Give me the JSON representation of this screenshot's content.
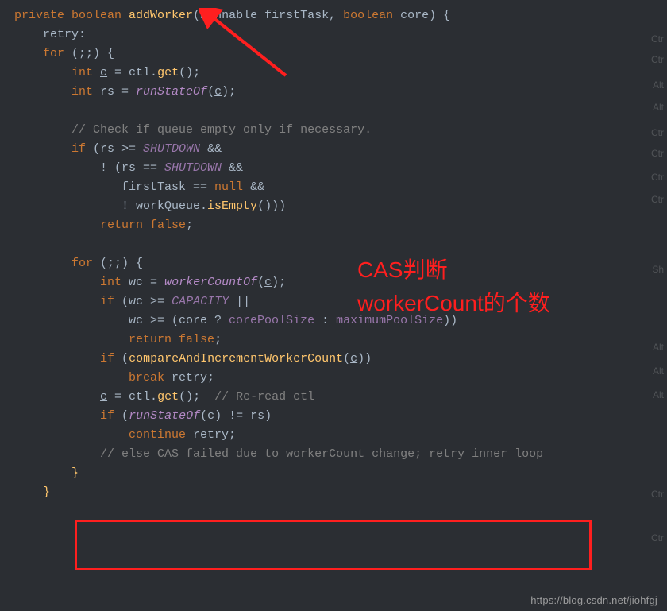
{
  "code": {
    "l0": {
      "a": "private ",
      "b": "boolean ",
      "c": "addWorker",
      "d": "(",
      "e": "Runnable ",
      "f": "firstTask",
      "g": ", ",
      "h": "boolean ",
      "i": "core",
      "j": ") {"
    },
    "l1": "    retry:",
    "l2": {
      "a": "    ",
      "b": "for ",
      "c": "(;;) {"
    },
    "l3": {
      "a": "        ",
      "b": "int ",
      "c": "c",
      "d": " = ctl.",
      "e": "get",
      "f": "();"
    },
    "l4": {
      "a": "        ",
      "b": "int ",
      "c": "rs = ",
      "d": "runStateOf",
      "e": "(",
      "f": "c",
      "g": ");"
    },
    "l5": "",
    "l6": {
      "a": "        ",
      "b": "// Check if queue empty only if necessary."
    },
    "l7": {
      "a": "        ",
      "b": "if ",
      "c": "(rs >= ",
      "d": "SHUTDOWN ",
      "e": "&&"
    },
    "l8": {
      "a": "            ! (rs == ",
      "b": "SHUTDOWN ",
      "c": "&&"
    },
    "l9": {
      "a": "               firstTask == ",
      "b": "null ",
      "c": "&&"
    },
    "l10": {
      "a": "               ! workQueue.",
      "b": "isEmpty",
      "c": "()))"
    },
    "l11": {
      "a": "            ",
      "b": "return false",
      "c": ";"
    },
    "l12": "",
    "l13": {
      "a": "        ",
      "b": "for ",
      "c": "(;;) {"
    },
    "l14": {
      "a": "            ",
      "b": "int ",
      "c": "wc = ",
      "d": "workerCountOf",
      "e": "(",
      "f": "c",
      "g": ");"
    },
    "l15": {
      "a": "            ",
      "b": "if ",
      "c": "(wc >= ",
      "d": "CAPACITY ",
      "e": "||"
    },
    "l16": {
      "a": "                wc >= (core ? ",
      "b": "corePoolSize ",
      "c": ": ",
      "d": "maximumPoolSize",
      "e": "))"
    },
    "l17": {
      "a": "                ",
      "b": "return false",
      "c": ";"
    },
    "l18": {
      "a": "            ",
      "b": "if ",
      "c": "(",
      "d": "compareAndIncrementWorkerCount",
      "e": "(",
      "f": "c",
      "g": "))"
    },
    "l19": {
      "a": "                ",
      "b": "break ",
      "c": "retry;"
    },
    "l20": {
      "a": "            ",
      "b": "c",
      "c": " = ctl.",
      "d": "get",
      "e": "();  ",
      "f": "// Re-read ctl"
    },
    "l21": {
      "a": "            ",
      "b": "if ",
      "c": "(",
      "d": "runStateOf",
      "e": "(",
      "f": "c",
      "g": ") != rs)"
    },
    "l22": {
      "a": "                ",
      "b": "continue ",
      "c": "retry;"
    },
    "l23": {
      "a": "            ",
      "b": "// else CAS failed due to workerCount change; retry inner loop"
    },
    "l24": "        }",
    "l25": "    }"
  },
  "annotations": {
    "line1": "CAS判断",
    "line2": "workerCount的个数"
  },
  "hints": {
    "h0": "Ctr",
    "h1": "Ctr",
    "h2": "Alt",
    "h3": "Alt",
    "h4": "Ctr",
    "h5": "Ctr",
    "h6": "Ctr",
    "h7": "Ctr",
    "h8": "Sh",
    "h9": "Alt",
    "h10": "Alt",
    "h11": "Alt",
    "h12": "Ctr",
    "h13": "Ctr"
  },
  "watermark": "https://blog.csdn.net/jiohfgj"
}
